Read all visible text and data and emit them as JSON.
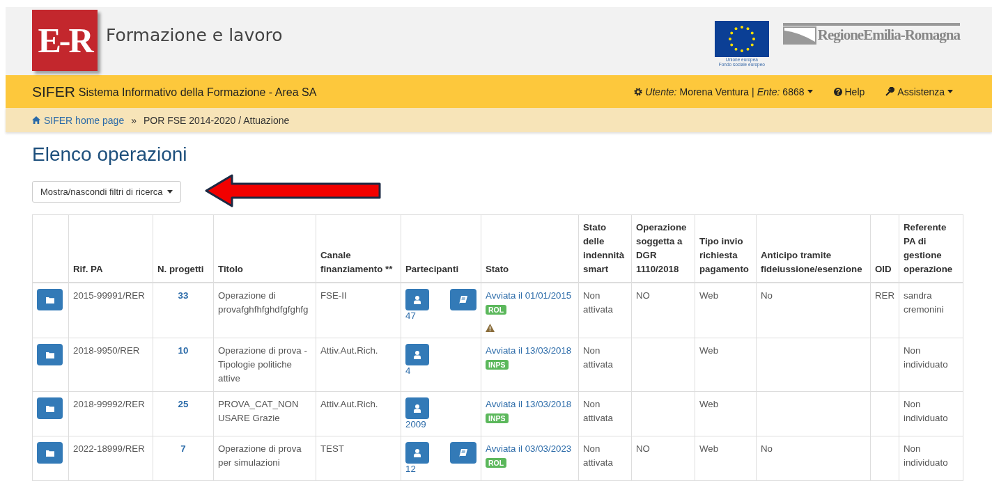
{
  "header": {
    "logo_text": "E-R",
    "title": "Formazione e lavoro",
    "eu_caption": [
      "Unione europea",
      "Fondo sociale europeo"
    ],
    "region_logo_text": "RegioneEmilia-Romagna"
  },
  "navbar": {
    "brand": "SIFER",
    "subtitle": "Sistema Informativo della Formazione - Area SA",
    "user_label": "Utente:",
    "user": "Morena Ventura |",
    "ente_label": "Ente:",
    "ente": "6868",
    "help": "Help",
    "assistance": "Assistenza"
  },
  "breadcrumb": {
    "items": [
      {
        "label": "SIFER home page",
        "link": true
      },
      {
        "label": "POR FSE 2014-2020 / Attuazione",
        "link": false
      }
    ],
    "separator": "»"
  },
  "page_title": "Elenco operazioni",
  "filter_button": "Mostra/nascondi filtri di ricerca",
  "table": {
    "columns": [
      "",
      "Rif. PA",
      "N. progetti",
      "Titolo",
      "Canale finanziamento **",
      "Partecipanti",
      "Stato",
      "Stato delle indennità smart",
      "Operazione soggetta a DGR 1110/2018",
      "Tipo invio richiesta pagamento",
      "Anticipo tramite fideiussione/esenzione",
      "OID",
      "Referente PA di gestione operazione"
    ],
    "rows": [
      {
        "rif": "2015-99991/RER",
        "progetti": "33",
        "titolo": "Operazione di provafghfhfghdfgfghfg",
        "canale": "FSE-II",
        "partecipanti": "47",
        "document": true,
        "stato": "Avviata il 01/01/2015",
        "tag": "ROL",
        "warning": true,
        "indennita": "Non attivata",
        "dgr": "NO",
        "tipo_invio": "Web",
        "anticipo": "No",
        "oid": "RER",
        "referente": "sandra cremonini"
      },
      {
        "rif": "2018-9950/RER",
        "progetti": "10",
        "titolo": "Operazione di prova - Tipologie politiche attive",
        "canale": "Attiv.Aut.Rich.",
        "partecipanti": "4",
        "document": false,
        "stato": "Avviata il 13/03/2018",
        "tag": "INPS",
        "warning": false,
        "indennita": "Non attivata",
        "dgr": "",
        "tipo_invio": "Web",
        "anticipo": "",
        "oid": "",
        "referente": "Non individuato"
      },
      {
        "rif": "2018-99992/RER",
        "progetti": "25",
        "titolo": "PROVA_CAT_NON USARE Grazie",
        "canale": "Attiv.Aut.Rich.",
        "partecipanti": "2009",
        "document": false,
        "stato": "Avviata il 13/03/2018",
        "tag": "INPS",
        "warning": false,
        "indennita": "Non attivata",
        "dgr": "",
        "tipo_invio": "Web",
        "anticipo": "",
        "oid": "",
        "referente": "Non individuato"
      },
      {
        "rif": "2022-18999/RER",
        "progetti": "7",
        "titolo": "Operazione di prova per simulazioni",
        "canale": "TEST",
        "partecipanti": "12",
        "document": true,
        "stato": "Avviata il 03/03/2023",
        "tag": "ROL",
        "warning": false,
        "indennita": "Non attivata",
        "dgr": "NO",
        "tipo_invio": "Web",
        "anticipo": "No",
        "oid": "",
        "referente": "Non individuato"
      }
    ]
  }
}
